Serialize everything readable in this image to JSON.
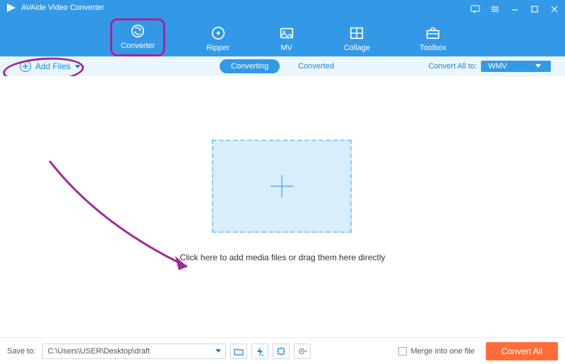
{
  "app": {
    "title": "AVAide Video Converter"
  },
  "tabs": [
    {
      "label": "Converter"
    },
    {
      "label": "Ripper"
    },
    {
      "label": "MV"
    },
    {
      "label": "Collage"
    },
    {
      "label": "Toolbox"
    }
  ],
  "subbar": {
    "add_files": "Add Files",
    "converting": "Converting",
    "converted": "Converted",
    "convert_all_to": "Convert All to:",
    "format": "WMV"
  },
  "main": {
    "drop_text": "Click here to add media files or drag them here directly"
  },
  "footer": {
    "save_to": "Save to:",
    "path": "C:\\Users\\USER\\Desktop\\draft",
    "merge": "Merge into one file",
    "convert_all": "Convert All"
  }
}
